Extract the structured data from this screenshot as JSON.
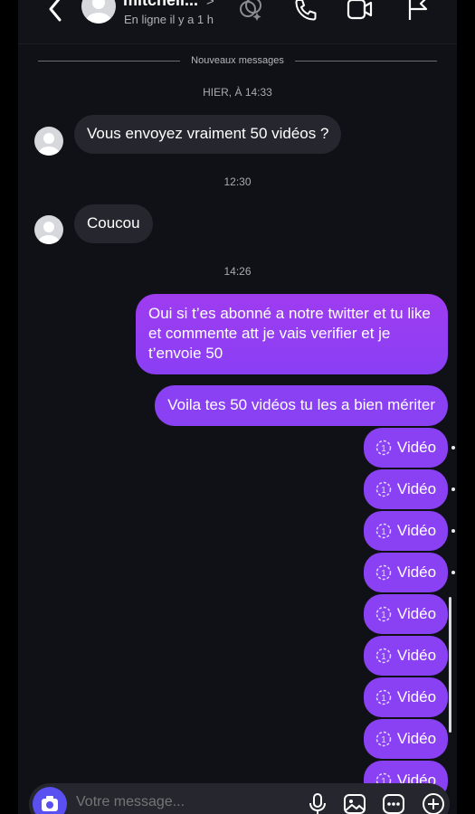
{
  "header": {
    "contact_name": "mitchell...",
    "status": "En ligne il y a 1 h",
    "chevron": ">",
    "icons": [
      "back-arrow-icon",
      "effects-icon",
      "phone-icon",
      "video-camera-icon",
      "flag-icon"
    ]
  },
  "chat": {
    "new_messages_label": "Nouveaux messages",
    "timestamps": [
      "HIER, À 14:33",
      "12:30",
      "14:26"
    ],
    "incoming": [
      "Vous envoyez vraiment 50 vidéos ?",
      "Coucou"
    ],
    "outgoing": [
      "Oui si t’es abonné a notre twitter et tu like et commente att je vais verifier et je t’envoie 50",
      "Voila tes 50 vidéos tu les a bien mériter"
    ],
    "video_label": "Vidéo",
    "video_count_visible": 9
  },
  "composer": {
    "placeholder": "Votre message..."
  },
  "colors": {
    "background": "#101116",
    "incoming_bubble": "#26272e",
    "outgoing_bubble": "#8a41f4",
    "camera_button": "#5a4ff0"
  }
}
